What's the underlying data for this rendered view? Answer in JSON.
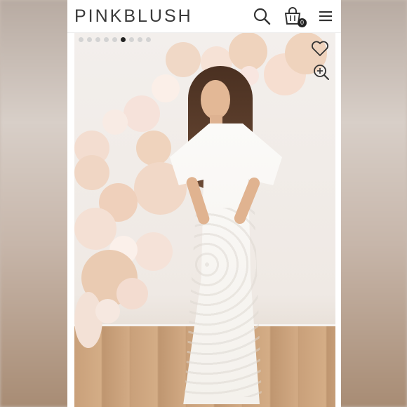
{
  "header": {
    "logo": "PINKBLUSH",
    "bag_count": "0",
    "icons": [
      "search-icon",
      "bag-icon",
      "menu-icon"
    ]
  },
  "gallery": {
    "total_images": 9,
    "active_index": 5,
    "icons": [
      "heart-icon",
      "zoom-icon"
    ]
  },
  "colors": {
    "brand_text": "#3a3a3a",
    "active_dot": "#222222",
    "inactive_dot": "#d3d3d3"
  }
}
